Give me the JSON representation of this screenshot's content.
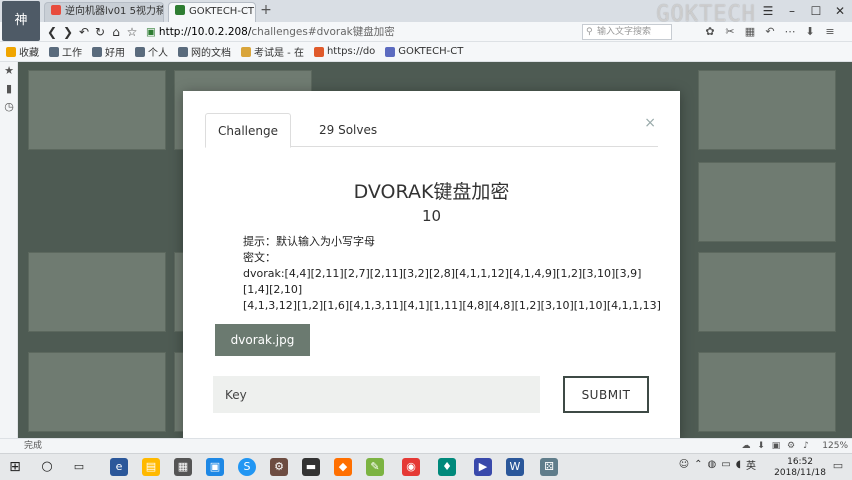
{
  "browser": {
    "tabs": [
      {
        "title": "逆向机器lv01 5视力稿]"
      },
      {
        "title": "GOKTECH-CTF"
      }
    ],
    "url_host": "http://10.0.2.208/",
    "url_path": "challenges#dvorak键盘加密",
    "search_placeholder": "输入文字搜索",
    "watermark": "GOKTECH"
  },
  "bookmarks": [
    {
      "label": "收藏",
      "color": "#f0a500"
    },
    {
      "label": "工作",
      "color": "#5a6b7d"
    },
    {
      "label": "好用",
      "color": "#5a6b7d"
    },
    {
      "label": "个人",
      "color": "#5a6b7d"
    },
    {
      "label": "网的文档",
      "color": "#5a6b7d"
    },
    {
      "label": "考试是 - 在",
      "color": "#d9a53b"
    },
    {
      "label": "https://do",
      "color": "#e05a2b"
    },
    {
      "label": "GOKTECH-CT",
      "color": "#5c6bc0"
    }
  ],
  "modal": {
    "tab_challenge": "Challenge",
    "tab_solves": "29 Solves",
    "close": "×",
    "title": "DVORAK键盘加密",
    "value": "10",
    "hint": "提示：默认输入为小写字母",
    "cipher_label": "密文：",
    "line1": "dvorak:[4,4][2,11][2,7][2,11][3,2][2,8][4,1,1,12][4,1,4,9][1,2][3,10][3,9]",
    "line2": "[1,4][2,10]",
    "line3": "[4,1,3,12][1,2][1,6][4,1,3,11][4,1][1,11][4,8][4,8][1,2][3,10][1,10][4,1,1,13]",
    "file_label": "dvorak.jpg",
    "key_placeholder": "Key",
    "submit_label": "SUBMIT"
  },
  "status": {
    "text": "完成",
    "zoom": "125%"
  },
  "taskbar": {
    "ime": "英",
    "time": "16:52",
    "date": "2018/11/18"
  }
}
